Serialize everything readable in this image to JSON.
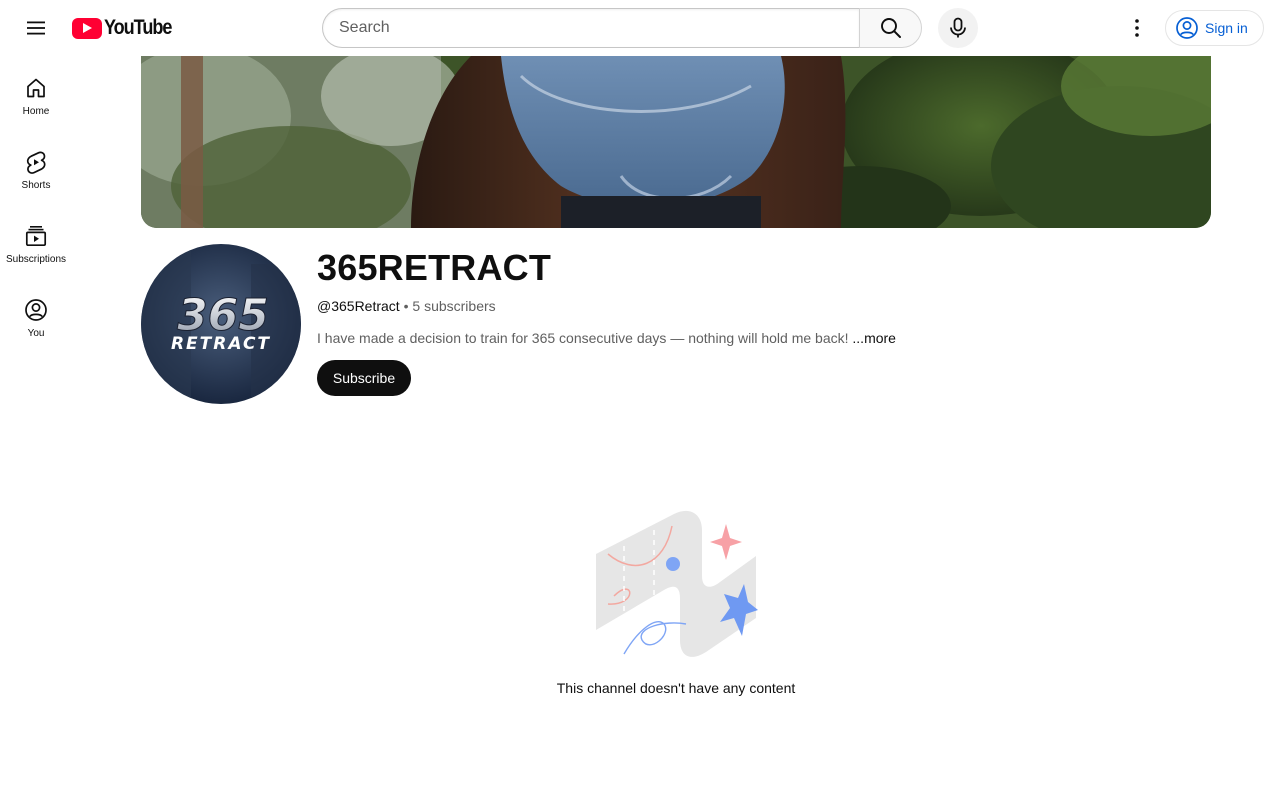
{
  "header": {
    "logo_text": "YouTube",
    "search_placeholder": "Search",
    "sign_in_label": "Sign in",
    "icons": {
      "menu": "menu-icon",
      "search": "search-icon",
      "mic": "microphone-icon",
      "more": "more-vertical-icon",
      "account": "account-circle-icon"
    }
  },
  "sidebar": {
    "items": [
      {
        "label": "Home",
        "icon": "home-icon"
      },
      {
        "label": "Shorts",
        "icon": "shorts-icon"
      },
      {
        "label": "Subscriptions",
        "icon": "subscriptions-icon"
      },
      {
        "label": "You",
        "icon": "you-icon"
      }
    ]
  },
  "channel": {
    "title": "365RETRACT",
    "handle": "@365Retract",
    "separator": " • ",
    "subscribers": "5 subscribers",
    "description": "I have made a decision to train for 365 consecutive days — nothing will hold me back! ",
    "more_label": "...more",
    "subscribe_label": "Subscribe",
    "avatar_logo_line1": "365",
    "avatar_logo_line2": "RETRACT"
  },
  "empty_state": {
    "message": "This channel doesn't have any content"
  },
  "colors": {
    "brand_red": "#ff0033",
    "link_blue": "#065fd4",
    "button_dark": "#0f0f0f",
    "secondary_text": "#606060"
  }
}
